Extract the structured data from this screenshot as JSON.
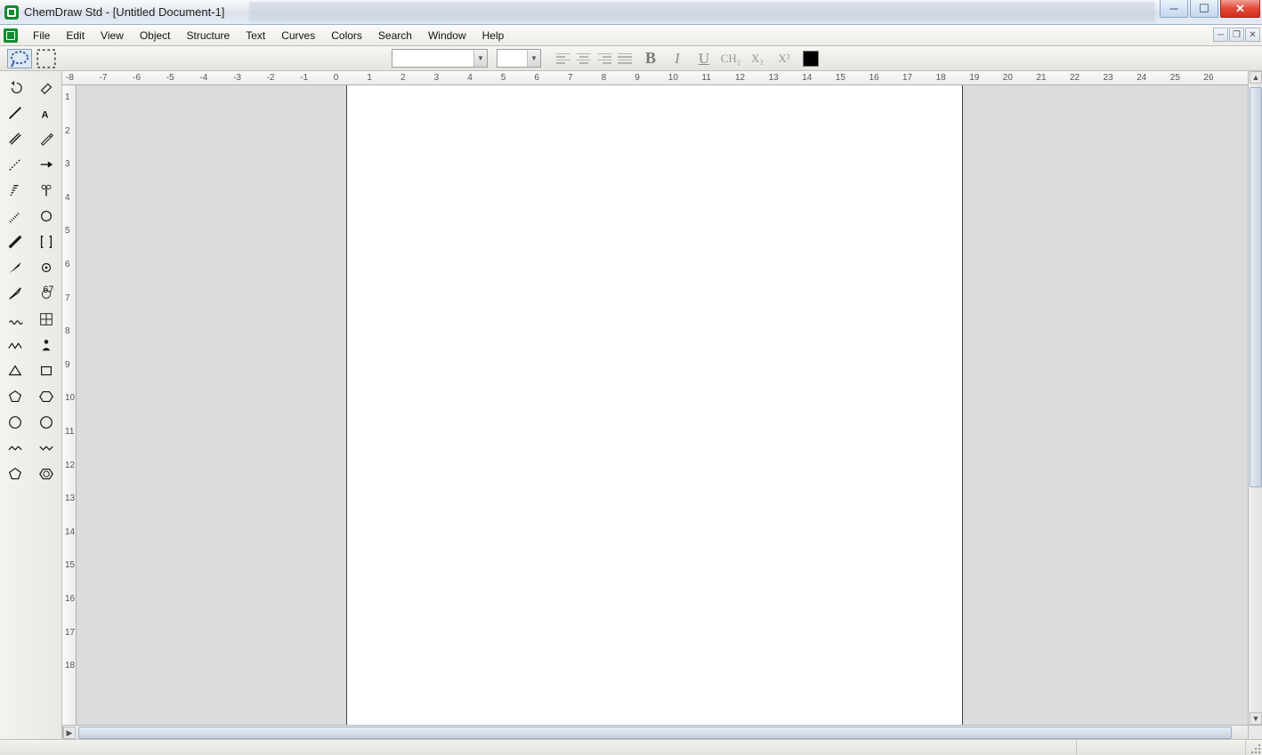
{
  "titlebar": {
    "app_name": "ChemDraw Std",
    "doc_name": "[Untitled Document-1]",
    "full_title": "ChemDraw Std - [Untitled Document-1]"
  },
  "window_controls": {
    "minimize": "─",
    "maximize": "☐",
    "close": "✕"
  },
  "mdi_controls": {
    "minimize": "─",
    "restore": "❐",
    "close": "✕"
  },
  "menus": [
    "File",
    "Edit",
    "View",
    "Object",
    "Structure",
    "Text",
    "Curves",
    "Colors",
    "Search",
    "Window",
    "Help"
  ],
  "format_toolbar": {
    "font_value": "",
    "size_value": "",
    "bold": "B",
    "italic": "I",
    "underline": "U",
    "formula": "CH₂",
    "subscript": "X₂",
    "superscript": "X²",
    "color": "#000000"
  },
  "tool_palette": [
    {
      "name": "undo-icon",
      "tip": "Undo"
    },
    {
      "name": "eraser-icon",
      "tip": "Eraser"
    },
    {
      "name": "solid-bond-icon",
      "tip": "Solid Bond"
    },
    {
      "name": "text-icon",
      "tip": "Text"
    },
    {
      "name": "multiple-bond-icon",
      "tip": "Multiple Bonds"
    },
    {
      "name": "pen-icon",
      "tip": "Pen"
    },
    {
      "name": "dashed-bond-icon",
      "tip": "Dashed Bond"
    },
    {
      "name": "arrow-icon",
      "tip": "Arrow"
    },
    {
      "name": "hashed-wedge-icon",
      "tip": "Hashed Wedge"
    },
    {
      "name": "chem-symbol-icon",
      "tip": "Chemical Symbol"
    },
    {
      "name": "hashed-bond-icon",
      "tip": "Hashed Bond"
    },
    {
      "name": "orbital-icon",
      "tip": "Orbital"
    },
    {
      "name": "bold-bond-icon",
      "tip": "Bold Bond"
    },
    {
      "name": "brackets-icon",
      "tip": "Drawing Elements"
    },
    {
      "name": "wedge-bond-icon",
      "tip": "Wedge Bond"
    },
    {
      "name": "query-atom-icon",
      "tip": "Atom Reaction"
    },
    {
      "name": "hollow-wedge-icon",
      "tip": "Hollow Wedge"
    },
    {
      "name": "templates-icon",
      "tip": "Templates"
    },
    {
      "name": "wavy-bond-icon",
      "tip": "Wavy Bond"
    },
    {
      "name": "table-icon",
      "tip": "Table"
    },
    {
      "name": "acyclic-chain-icon",
      "tip": "Acyclic Chain"
    },
    {
      "name": "person-icon",
      "tip": "Structure"
    },
    {
      "name": "triangle-icon",
      "tip": "Cyclopropane"
    },
    {
      "name": "rectangle-icon",
      "tip": "Cyclobutane"
    },
    {
      "name": "pentagon-icon",
      "tip": "Cyclopentane"
    },
    {
      "name": "hexagon-icon",
      "tip": "Cyclohexane"
    },
    {
      "name": "heptagon-icon",
      "tip": "Cycloheptane"
    },
    {
      "name": "octagon-icon",
      "tip": "Cyclooctane"
    },
    {
      "name": "chair1-icon",
      "tip": "Chair 1"
    },
    {
      "name": "chair2-icon",
      "tip": "Chair 2"
    },
    {
      "name": "pentagon2-icon",
      "tip": "Cyclopentadiene"
    },
    {
      "name": "benzene-icon",
      "tip": "Benzene"
    }
  ],
  "ruler_h": [
    " -8",
    "-7",
    "-6",
    "-5",
    "-4",
    "-3",
    "-2",
    "-1",
    "0",
    "1",
    "2",
    "3",
    "4",
    "5",
    "6",
    "7",
    "8",
    "9",
    "10",
    "11",
    "12",
    "13",
    "14",
    "15",
    "16",
    "17",
    "18",
    "19",
    "20",
    "21",
    "22",
    "23",
    "24",
    "25",
    "26"
  ],
  "ruler_v": [
    "1",
    "2",
    "3",
    "4",
    "5",
    "6",
    "7",
    "8",
    "9",
    "10",
    "11",
    "12",
    "13",
    "14",
    "15",
    "16",
    "17",
    "18"
  ],
  "status": {
    "left": "",
    "right": ""
  }
}
